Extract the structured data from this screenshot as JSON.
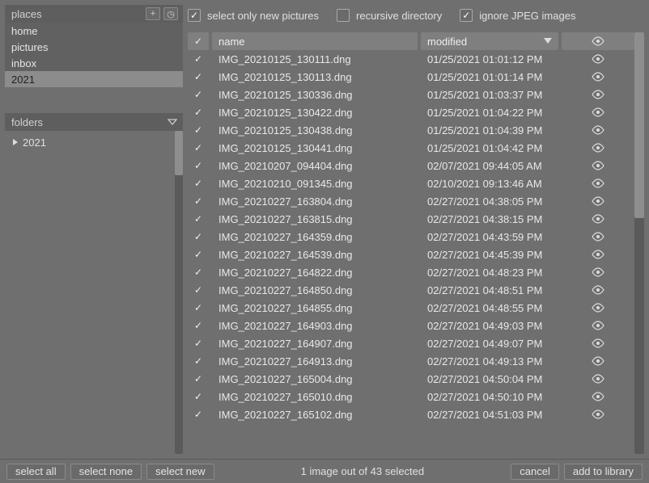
{
  "sidebar": {
    "places": {
      "title": "places",
      "add_icon": "+",
      "clock_icon": "◷",
      "items": [
        {
          "label": "home",
          "selected": false
        },
        {
          "label": "pictures",
          "selected": false
        },
        {
          "label": "inbox",
          "selected": false
        },
        {
          "label": "2021",
          "selected": true
        }
      ]
    },
    "folders": {
      "title": "folders",
      "items": [
        {
          "label": "2021",
          "expanded": false
        }
      ]
    }
  },
  "options": {
    "select_new": {
      "label": "select only new pictures",
      "checked": true
    },
    "recursive": {
      "label": "recursive directory",
      "checked": false
    },
    "ignore_jpeg": {
      "label": "ignore JPEG images",
      "checked": true
    }
  },
  "table": {
    "headers": {
      "name": "name",
      "modified": "modified"
    },
    "rows": [
      {
        "checked": true,
        "name": "IMG_20210125_130111.dng",
        "modified": "01/25/2021 01:01:12 PM",
        "visible": true
      },
      {
        "checked": true,
        "name": "IMG_20210125_130113.dng",
        "modified": "01/25/2021 01:01:14 PM",
        "visible": true
      },
      {
        "checked": true,
        "name": "IMG_20210125_130336.dng",
        "modified": "01/25/2021 01:03:37 PM",
        "visible": true
      },
      {
        "checked": true,
        "name": "IMG_20210125_130422.dng",
        "modified": "01/25/2021 01:04:22 PM",
        "visible": true
      },
      {
        "checked": true,
        "name": "IMG_20210125_130438.dng",
        "modified": "01/25/2021 01:04:39 PM",
        "visible": true
      },
      {
        "checked": true,
        "name": "IMG_20210125_130441.dng",
        "modified": "01/25/2021 01:04:42 PM",
        "visible": true
      },
      {
        "checked": true,
        "name": "IMG_20210207_094404.dng",
        "modified": "02/07/2021 09:44:05 AM",
        "visible": true
      },
      {
        "checked": true,
        "name": "IMG_20210210_091345.dng",
        "modified": "02/10/2021 09:13:46 AM",
        "visible": true
      },
      {
        "checked": true,
        "name": "IMG_20210227_163804.dng",
        "modified": "02/27/2021 04:38:05 PM",
        "visible": true
      },
      {
        "checked": true,
        "name": "IMG_20210227_163815.dng",
        "modified": "02/27/2021 04:38:15 PM",
        "visible": true
      },
      {
        "checked": true,
        "name": "IMG_20210227_164359.dng",
        "modified": "02/27/2021 04:43:59 PM",
        "visible": true
      },
      {
        "checked": true,
        "name": "IMG_20210227_164539.dng",
        "modified": "02/27/2021 04:45:39 PM",
        "visible": true
      },
      {
        "checked": true,
        "name": "IMG_20210227_164822.dng",
        "modified": "02/27/2021 04:48:23 PM",
        "visible": true
      },
      {
        "checked": true,
        "name": "IMG_20210227_164850.dng",
        "modified": "02/27/2021 04:48:51 PM",
        "visible": true
      },
      {
        "checked": true,
        "name": "IMG_20210227_164855.dng",
        "modified": "02/27/2021 04:48:55 PM",
        "visible": true
      },
      {
        "checked": true,
        "name": "IMG_20210227_164903.dng",
        "modified": "02/27/2021 04:49:03 PM",
        "visible": true
      },
      {
        "checked": true,
        "name": "IMG_20210227_164907.dng",
        "modified": "02/27/2021 04:49:07 PM",
        "visible": true
      },
      {
        "checked": true,
        "name": "IMG_20210227_164913.dng",
        "modified": "02/27/2021 04:49:13 PM",
        "visible": true
      },
      {
        "checked": true,
        "name": "IMG_20210227_165004.dng",
        "modified": "02/27/2021 04:50:04 PM",
        "visible": true
      },
      {
        "checked": true,
        "name": "IMG_20210227_165010.dng",
        "modified": "02/27/2021 04:50:10 PM",
        "visible": true
      },
      {
        "checked": true,
        "name": "IMG_20210227_165102.dng",
        "modified": "02/27/2021 04:51:03 PM",
        "visible": true
      }
    ]
  },
  "buttons": {
    "select_all": "select all",
    "select_none": "select none",
    "select_new": "select new",
    "cancel": "cancel",
    "add_to_library": "add to library"
  },
  "status": "1 image out of 43 selected"
}
